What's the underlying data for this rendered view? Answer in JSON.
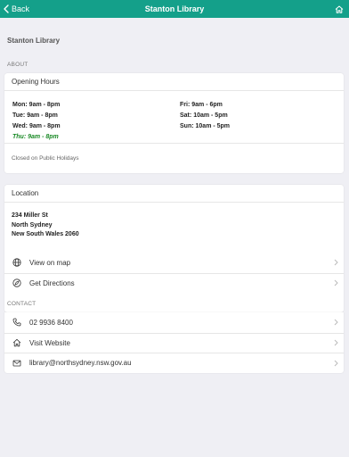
{
  "nav": {
    "back_label": "Back",
    "title": "Stanton Library",
    "home_icon": "home-icon"
  },
  "page_heading": "Stanton Library",
  "about_label": "ABOUT",
  "opening_hours": {
    "title": "Opening Hours",
    "left_column": [
      {
        "day": "Mon:",
        "hours": "9am - 8pm",
        "today": false
      },
      {
        "day": "Tue:",
        "hours": "9am - 8pm",
        "today": false
      },
      {
        "day": "Wed:",
        "hours": "9am - 8pm",
        "today": false
      },
      {
        "day": "Thu:",
        "hours": "9am - 8pm",
        "today": true
      }
    ],
    "right_column": [
      {
        "day": "Fri:",
        "hours": "9am - 6pm",
        "today": false
      },
      {
        "day": "Sat:",
        "hours": "10am - 5pm",
        "today": false
      },
      {
        "day": "Sun:",
        "hours": "10am - 5pm",
        "today": false
      }
    ],
    "today_color": "#1a8a26",
    "note": "Closed on Public Holidays"
  },
  "location": {
    "title": "Location",
    "address_lines": [
      "234 Miller St",
      "North Sydney",
      "New South Wales 2060"
    ],
    "actions": [
      {
        "label": "View on map",
        "icon": "globe-icon"
      },
      {
        "label": "Get Directions",
        "icon": "compass-icon"
      }
    ]
  },
  "contact_label": "CONTACT",
  "contact": [
    {
      "label": "02 9936 8400",
      "icon": "phone-icon"
    },
    {
      "label": "Visit Website",
      "icon": "home-icon"
    },
    {
      "label": "library@northsydney.nsw.gov.au",
      "icon": "mail-icon"
    }
  ],
  "colors": {
    "nav_bar": "#14a08a",
    "background": "#efeff4"
  }
}
